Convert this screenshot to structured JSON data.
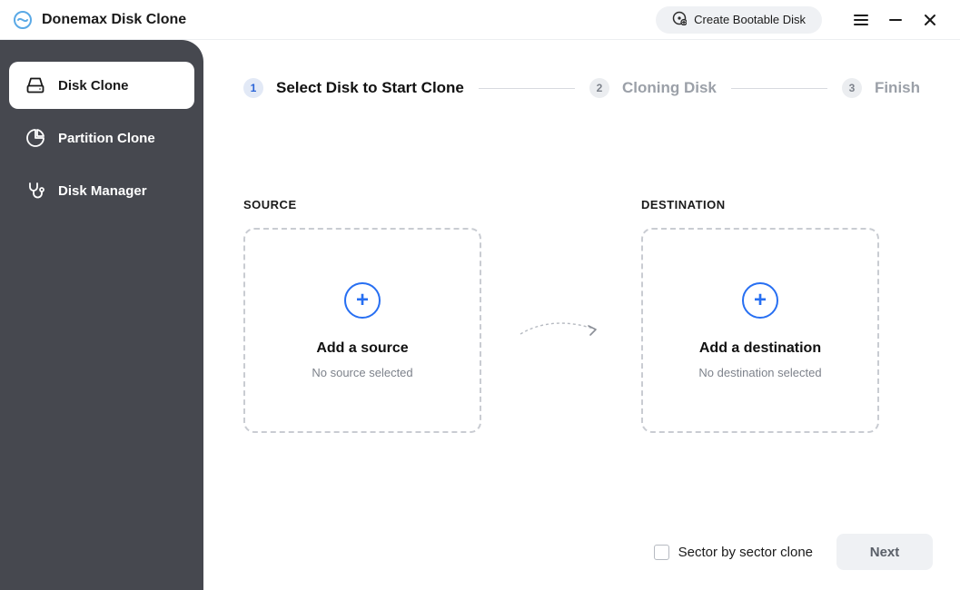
{
  "app": {
    "title": "Donemax Disk Clone",
    "accent_color": "#276ff2",
    "sidebar_bg": "#46484f"
  },
  "titlebar": {
    "create_bootable_label": "Create Bootable Disk"
  },
  "sidebar": {
    "items": [
      {
        "label": "Disk Clone",
        "active": true
      },
      {
        "label": "Partition Clone",
        "active": false
      },
      {
        "label": "Disk Manager",
        "active": false
      }
    ]
  },
  "steps": [
    {
      "num": "1",
      "label": "Select Disk to Start Clone",
      "active": true
    },
    {
      "num": "2",
      "label": "Cloning Disk",
      "active": false
    },
    {
      "num": "3",
      "label": "Finish",
      "active": false
    }
  ],
  "areas": {
    "source": {
      "section_label": "SOURCE",
      "title": "Add a source",
      "subtitle": "No source selected"
    },
    "destination": {
      "section_label": "DESTINATION",
      "title": "Add a destination",
      "subtitle": "No destination selected"
    }
  },
  "footer": {
    "sector_checkbox_label": "Sector by sector clone",
    "next_button_label": "Next"
  }
}
